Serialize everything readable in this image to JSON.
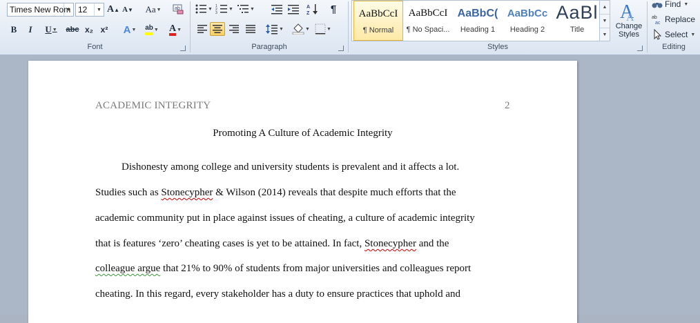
{
  "ribbon": {
    "font": {
      "label": "Font",
      "font_name": "Times New Rom",
      "font_size": "12",
      "buttons": {
        "bold": "B",
        "italic": "I",
        "underline": "U",
        "strike": "abc",
        "subscript": "x₂",
        "superscript": "x²",
        "grow": "A",
        "shrink": "A",
        "clear_format": "Aa",
        "font_color": "A",
        "highlight": "ab"
      }
    },
    "paragraph": {
      "label": "Paragraph",
      "pilcrow": "¶"
    },
    "styles": {
      "label": "Styles",
      "items": [
        {
          "preview": "AaBbCcI",
          "name": "¶ Normal"
        },
        {
          "preview": "AaBbCcI",
          "name": "¶ No Spaci..."
        },
        {
          "preview": "AaBbC(",
          "name": "Heading 1"
        },
        {
          "preview": "AaBbCc",
          "name": "Heading 2"
        },
        {
          "preview": "AaBl",
          "name": "Title"
        }
      ],
      "change_styles": "Change Styles"
    },
    "editing": {
      "label": "Editing",
      "find": "Find",
      "replace": "Replace",
      "select": "Select"
    }
  },
  "document": {
    "header": "ACADEMIC INTEGRITY",
    "page_number": "2",
    "title": "Promoting A Culture of Academic Integrity",
    "lines": [
      "Dishonesty among college and university students is prevalent and it affects a lot.",
      "reveals that despite much efforts that the",
      "academic community put in place against issues of cheating, a culture of academic integrity",
      "that is features ‘zero’ cheating cases is yet to be attained. In fact,",
      "and the",
      "that 21% to 90% of students from major universities and colleagues report",
      "cheating. In this regard, every stakeholder has a duty to ensure practices that uphold and"
    ],
    "line2_prefix": "Studies such as",
    "line2_name": "Stonecypher",
    "line2_mid": "& Wilson  (2014)",
    "line4_name": "Stonecypher",
    "line5_start": "colleague argue"
  },
  "colors": {
    "accent": "#f8cf63",
    "ribbon_bg": "#dbe5f1",
    "workspace": "#abb7c7",
    "spell_error": "#d40000"
  }
}
